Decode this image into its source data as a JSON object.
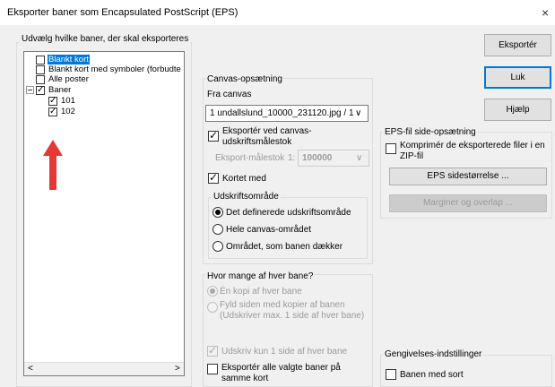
{
  "window": {
    "title": "Eksporter baner som Encapsulated PostScript (EPS)",
    "close_glyph": "×"
  },
  "layers_group": {
    "title": "Udvælg hvilke baner, der skal eksporteres",
    "items": [
      {
        "label": "Blankt kort",
        "checked": false,
        "selected": true
      },
      {
        "label": "Blankt kort med symboler (forbudte",
        "checked": false
      },
      {
        "label": "Alle poster",
        "checked": false
      },
      {
        "label": "Baner",
        "checked": true,
        "expanded": true
      },
      {
        "label": "101",
        "checked": true
      },
      {
        "label": "102",
        "checked": true
      }
    ]
  },
  "annotation": {
    "arrow_color": "#e53935"
  },
  "canvas_group": {
    "title": "Canvas-opsætning",
    "from_canvas_label": "Fra canvas",
    "canvas_select_value": "1 undallslund_10000_231120.jpg  / 1",
    "export_at_print_scale_label": "Eksportér ved canvas-udskriftsmålestok",
    "export_at_print_scale_checked": true,
    "export_scale_label": "Eksport-målestok",
    "export_scale_prefix": "1:",
    "export_scale_value": "100000",
    "map_with_label": "Kortet med",
    "map_with_checked": true
  },
  "print_area_group": {
    "title": "Udskriftsområde",
    "options": [
      {
        "label": "Det definerede udskriftsområde",
        "selected": true
      },
      {
        "label": "Hele canvas-området",
        "selected": false
      },
      {
        "label": "Området, som banen dækker",
        "selected": false
      }
    ]
  },
  "copies_group": {
    "title": "Hvor mange af hver bane?",
    "one_copy_label": "Én kopi af hver bane",
    "one_copy_selected": true,
    "fill_page_label": "Fyld siden med kopier af banen (Udskriver max. 1 side af hver bane)",
    "fill_page_selected": false,
    "print_one_page_label": "Udskriv kun 1 side af hver bane",
    "print_one_page_checked": true,
    "export_all_same_map_label": "Eksportér alle valgte baner på samme kort",
    "export_all_same_map_checked": false
  },
  "buttons": {
    "export": "Eksportér",
    "close": "Luk",
    "help": "Hjælp"
  },
  "eps_page_group": {
    "title": "EPS-fil side-opsætning",
    "compress_label": "Komprimér de eksporterede filer i en ZIP-fil",
    "compress_checked": false,
    "page_size_button": "EPS sidestørrelse ...",
    "margins_button": "Marginer og overlap ..."
  },
  "render_group": {
    "title": "Gengivelses-indstillinger",
    "black_courses_label": "Banen med sort",
    "black_courses_checked": false
  },
  "scrollbar": {
    "left_arrow": "<",
    "right_arrow": ">"
  },
  "dropdown_glyph": "∨"
}
